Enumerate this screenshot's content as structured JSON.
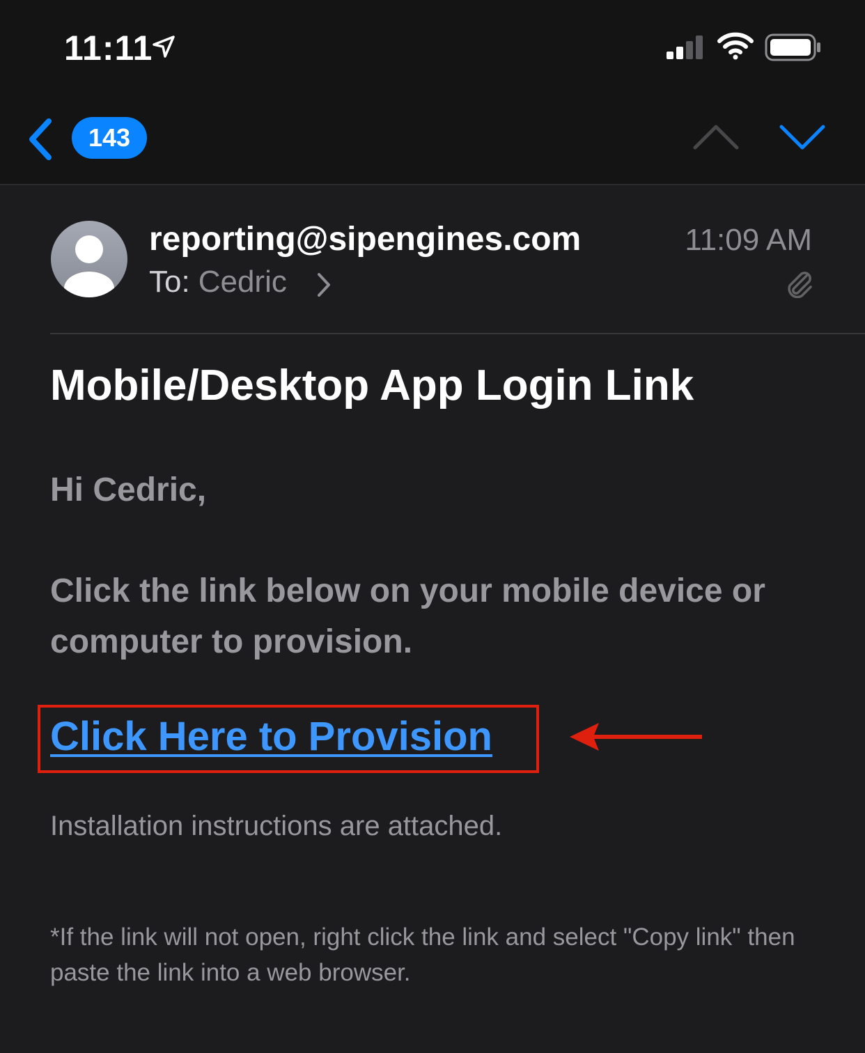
{
  "status_bar": {
    "time": "11:11",
    "icons": [
      "location-arrow-icon",
      "cellular-signal-icon",
      "wifi-icon",
      "battery-icon"
    ]
  },
  "nav": {
    "back_icon": "chevron-left-icon",
    "unread_count": "143",
    "previous_icon": "chevron-up-icon",
    "next_icon": "chevron-down-icon"
  },
  "message": {
    "sender": "reporting@sipengines.com",
    "date": "11:09 AM",
    "to_label": "To:",
    "to_name": "Cedric",
    "has_attachment_icon": "paperclip-icon",
    "subject": "Mobile/Desktop App Login Link",
    "greeting": "Hi Cedric,",
    "body": "Click the link below on your mobile device or computer to provision.",
    "link_text": "Click Here to Provision",
    "install_note": "Installation instructions are attached.",
    "footnote": "*If the link will not open, right click the link and select \"Copy link\" then paste the link into a web browser."
  },
  "colors": {
    "background": "#1c1c1e",
    "bar_background": "#141414",
    "accent": "#0a84ff",
    "link": "#3d97ff",
    "annotation": "#e0200f",
    "secondary_text": "#98989d"
  }
}
